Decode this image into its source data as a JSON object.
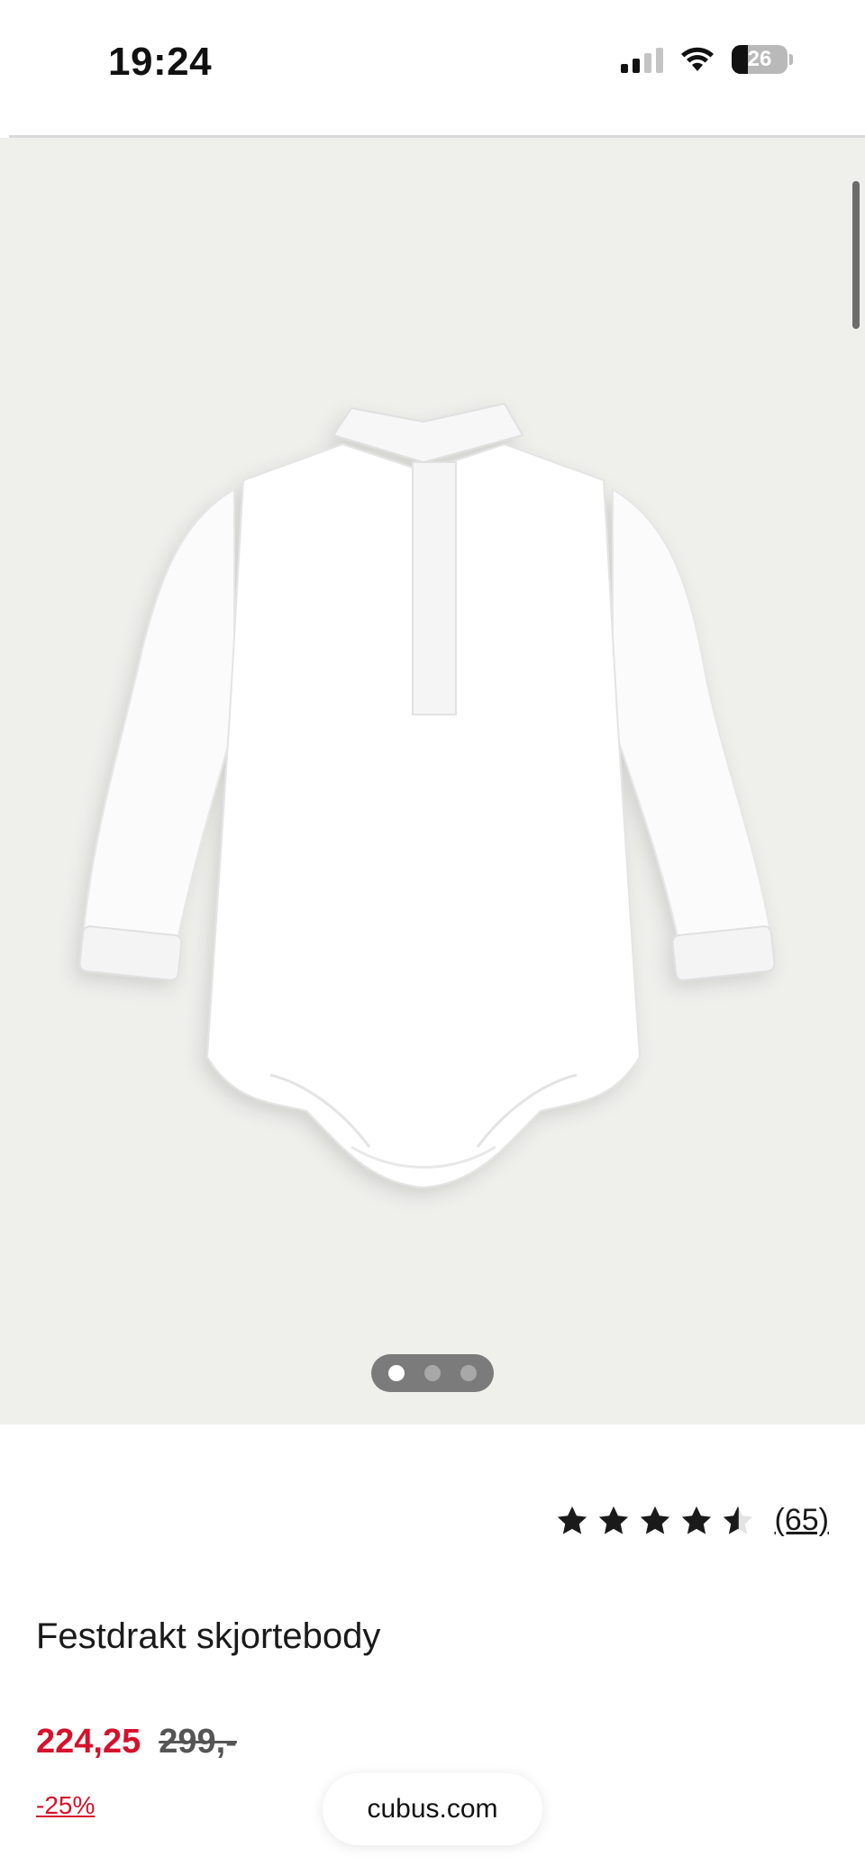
{
  "status_bar": {
    "time": "19:24",
    "battery_percent": "26",
    "signal_bars_active": 2,
    "signal_bars_total": 4
  },
  "gallery": {
    "image_alt": "white long-sleeve baby shirt bodysuit",
    "dots_total": 3,
    "active_dot": 1,
    "background_color": "#efefec"
  },
  "product": {
    "rating_value": 4.5,
    "rating_max": 5,
    "review_count": "(65)",
    "title": "Festdrakt skjortebody",
    "price_now": "224,25",
    "price_old": "299,-",
    "discount": "-25%"
  },
  "browser": {
    "url": "cubus.com"
  },
  "colors": {
    "sale_red": "#d6112b",
    "text": "#1a1a1a"
  }
}
